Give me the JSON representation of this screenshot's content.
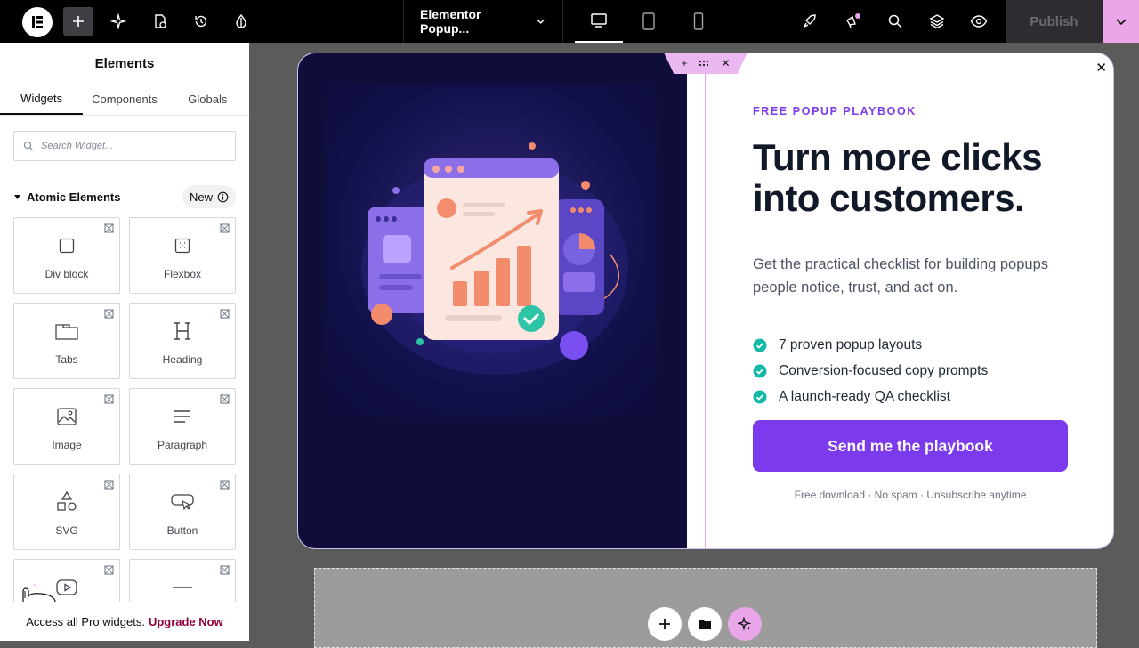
{
  "topbar": {
    "document_title": "Elementor Popup...",
    "publish_label": "Publish"
  },
  "panel": {
    "title": "Elements",
    "tabs": [
      {
        "label": "Widgets"
      },
      {
        "label": "Components"
      },
      {
        "label": "Globals"
      }
    ],
    "search_placeholder": "Search Widget...",
    "category": {
      "label": "Atomic Elements",
      "badge": "New"
    },
    "widgets": [
      {
        "label": "Div block",
        "icon": "div-block-icon"
      },
      {
        "label": "Flexbox",
        "icon": "flexbox-icon"
      },
      {
        "label": "Tabs",
        "icon": "tabs-icon"
      },
      {
        "label": "Heading",
        "icon": "heading-icon"
      },
      {
        "label": "Image",
        "icon": "image-icon"
      },
      {
        "label": "Paragraph",
        "icon": "paragraph-icon"
      },
      {
        "label": "SVG",
        "icon": "svg-icon"
      },
      {
        "label": "Button",
        "icon": "button-icon"
      },
      {
        "label": "",
        "icon": "video-icon"
      },
      {
        "label": "",
        "icon": "divider-icon"
      }
    ],
    "upgrade_text": "Access all Pro widgets.",
    "upgrade_link": "Upgrade Now"
  },
  "popup": {
    "eyebrow": "FREE POPUP PLAYBOOK",
    "headline": "Turn more clicks into customers.",
    "subtext": "Get the practical checklist for building popups people notice, trust, and act on.",
    "bullets": [
      "7 proven popup layouts",
      "Conversion-focused copy prompts",
      "A launch-ready QA checklist"
    ],
    "cta_label": "Send me the playbook",
    "fine_print": "Free download · No spam · Unsubscribe anytime"
  },
  "colors": {
    "accent": "#7c3aed",
    "check": "#14b8a6",
    "popup_left_bg": "#0f0d3a",
    "handle": "#eab7f0",
    "upgrade_link": "#93003f"
  }
}
